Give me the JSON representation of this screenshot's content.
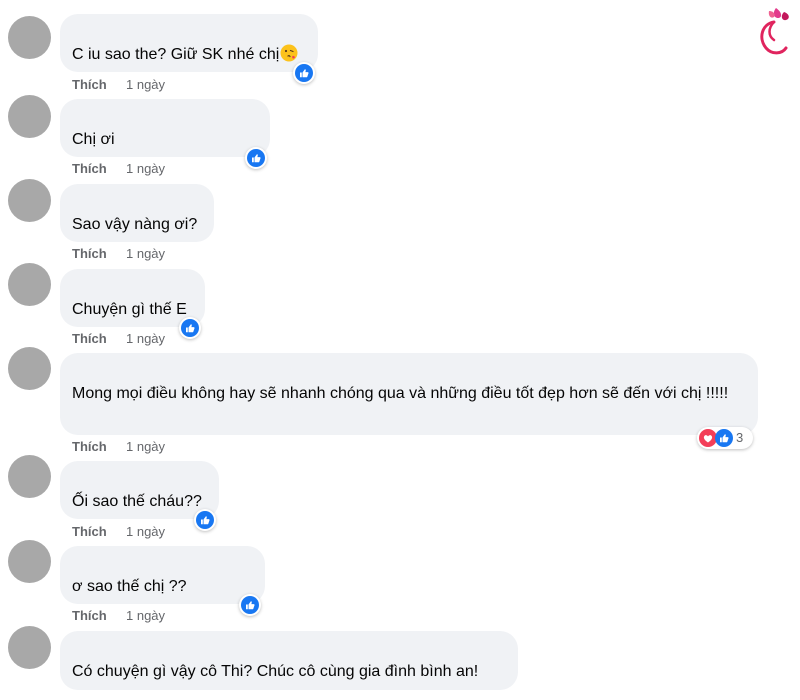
{
  "colors": {
    "bubble_bg": "#f0f2f5",
    "like_blue": "#1877f2",
    "love_red": "#f33e58",
    "meta_gray": "#65676b",
    "avatar_gray": "#a8a8a8"
  },
  "comments": [
    {
      "text": "C iu sao the? Giữ SK nhé chị",
      "emoji": "kiss-emoji",
      "like_label": "Thích",
      "time": "1 ngày",
      "reaction": "like-icon"
    },
    {
      "text": "Chị ơi",
      "like_label": "Thích",
      "time": "1 ngày",
      "reaction": "like-icon"
    },
    {
      "text": "Sao vậy nàng ơi?",
      "like_label": "Thích",
      "time": "1 ngày"
    },
    {
      "text": "Chuyện gì thế E",
      "like_label": "Thích",
      "time": "1 ngày",
      "reaction": "like-icon"
    },
    {
      "text": "Mong mọi điều không hay sẽ nhanh chóng qua và những điều tốt đẹp hơn sẽ đến với chị !!!!!",
      "like_label": "Thích",
      "time": "1 ngày",
      "reaction": "love-and-like-icons",
      "reaction_count": "3"
    },
    {
      "text": "Ối sao thế cháu??",
      "like_label": "Thích",
      "time": "1 ngày",
      "reaction": "like-icon"
    },
    {
      "text": "ơ sao thế chị ??",
      "like_label": "Thích",
      "time": "1 ngày",
      "reaction": "like-icon"
    },
    {
      "text": "Có chuyện gì vậy cô Thi? Chúc cô cùng gia đình bình an!"
    }
  ]
}
